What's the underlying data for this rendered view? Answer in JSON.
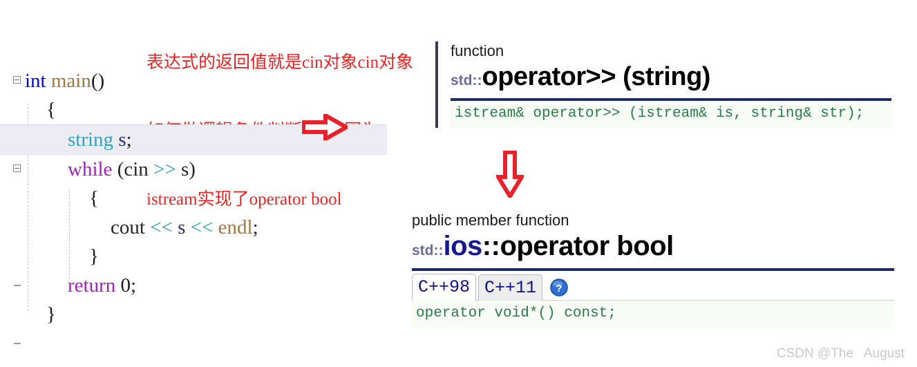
{
  "annotation": {
    "lines": [
      "表达式的返回值就是cin对象cin对象",
      "如何做逻辑条件判断的呢?因为",
      "istream实现了operator bool"
    ],
    "color": "#ee2222"
  },
  "editor": {
    "lines": [
      {
        "tokens": [
          {
            "t": "int ",
            "c": "kw"
          },
          {
            "t": "main",
            "c": "fn"
          },
          {
            "t": "()",
            "c": "brace"
          }
        ],
        "indent": 0,
        "marker": "box",
        "highlight": false
      },
      {
        "tokens": [
          {
            "t": "{",
            "c": "brace"
          }
        ],
        "indent": 1,
        "marker": "",
        "highlight": false
      },
      {
        "tokens": [
          {
            "t": "string",
            "c": "type"
          },
          {
            "t": " ",
            "c": "plain"
          },
          {
            "t": "s",
            "c": "var"
          },
          {
            "t": ";",
            "c": "plain"
          }
        ],
        "indent": 2,
        "marker": "",
        "highlight": true
      },
      {
        "tokens": [
          {
            "t": "while",
            "c": "ctrl"
          },
          {
            "t": " (cin ",
            "c": "plain"
          },
          {
            "t": ">>",
            "c": "op"
          },
          {
            "t": " s)",
            "c": "plain"
          }
        ],
        "indent": 2,
        "marker": "box",
        "highlight": false
      },
      {
        "tokens": [
          {
            "t": "{",
            "c": "brace"
          }
        ],
        "indent": 3,
        "marker": "",
        "highlight": false
      },
      {
        "tokens": [
          {
            "t": "cout ",
            "c": "plain"
          },
          {
            "t": "<<",
            "c": "op"
          },
          {
            "t": " ",
            "c": "plain"
          },
          {
            "t": "s",
            "c": "var"
          },
          {
            "t": " ",
            "c": "plain"
          },
          {
            "t": "<<",
            "c": "op"
          },
          {
            "t": " ",
            "c": "plain"
          },
          {
            "t": "endl",
            "c": "fn"
          },
          {
            "t": ";",
            "c": "plain"
          }
        ],
        "indent": 4,
        "marker": "",
        "highlight": false
      },
      {
        "tokens": [
          {
            "t": "}",
            "c": "brace"
          }
        ],
        "indent": 3,
        "marker": "",
        "highlight": false
      },
      {
        "tokens": [
          {
            "t": "return",
            "c": "ctrl"
          },
          {
            "t": " ",
            "c": "plain"
          },
          {
            "t": "0",
            "c": "num"
          },
          {
            "t": ";",
            "c": "plain"
          }
        ],
        "indent": 2,
        "marker": "dash",
        "highlight": false
      },
      {
        "tokens": [
          {
            "t": "}",
            "c": "brace"
          }
        ],
        "indent": 1,
        "marker": "",
        "highlight": false
      },
      {
        "tokens": [
          {
            "t": " ",
            "c": "plain"
          }
        ],
        "indent": 0,
        "marker": "dash",
        "highlight": false
      }
    ]
  },
  "reference_top": {
    "kind": "function",
    "namespace": "std::",
    "title": "operator>> (string)",
    "signature": "istream& operator>> (istream& is, string& str);"
  },
  "reference_bottom": {
    "kind": "public member function",
    "namespace": "std::",
    "class_name": "ios",
    "title_rest": "::operator bool",
    "tabs": [
      {
        "label": "C++98",
        "active": true
      },
      {
        "label": "C++11",
        "active": false
      }
    ],
    "help_icon": "help-question-icon",
    "signature": "operator void*() const;"
  },
  "arrows": {
    "right_arrow": "arrow-right-icon",
    "down_arrow": "arrow-down-icon",
    "color": "#e8212a"
  },
  "watermark": {
    "text": "CSDN @The   August"
  }
}
